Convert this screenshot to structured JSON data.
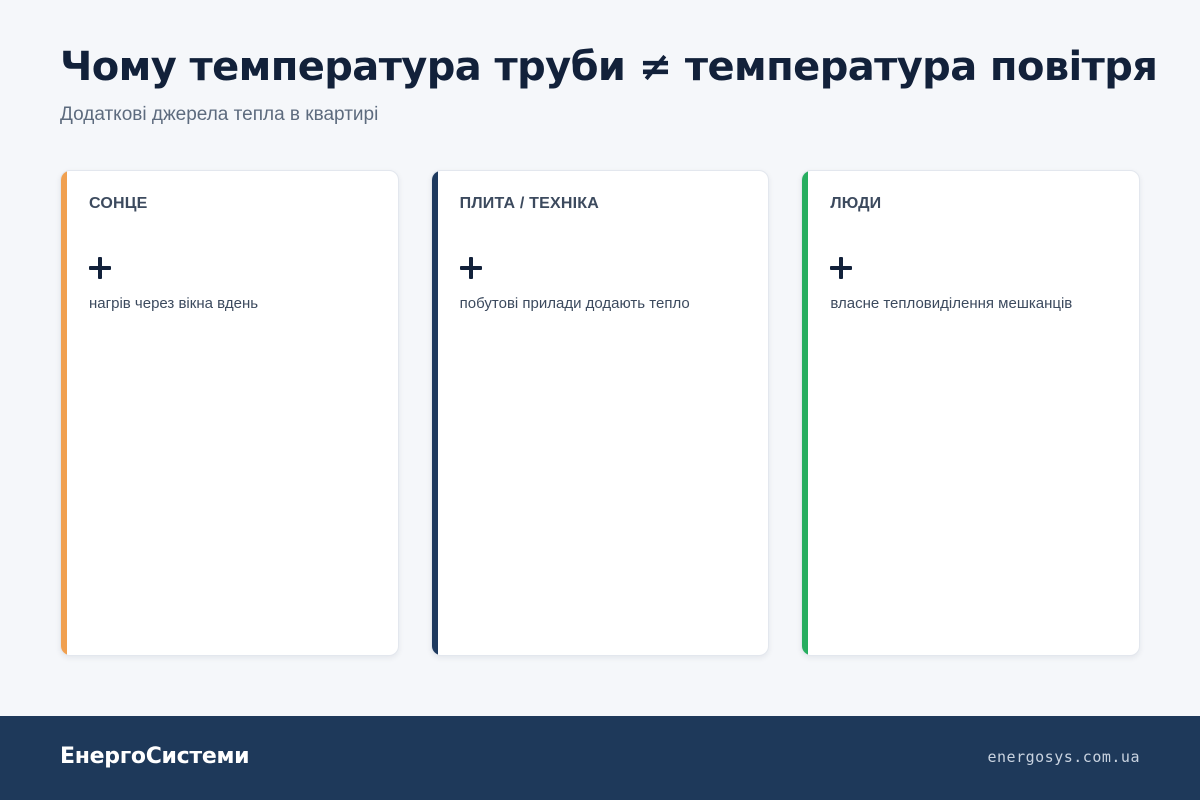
{
  "header": {
    "title": "Чому температура труби ≠ температура повітря",
    "subtitle": "Додаткові джерела тепла в квартирі"
  },
  "cards": [
    {
      "title": "СОНЦЕ",
      "sign": "+",
      "description": "нагрів через вікна вдень",
      "accent_color": "#f0a050"
    },
    {
      "title": "ПЛИТА / ТЕХНІКА",
      "sign": "+",
      "description": "побутові прилади додають тепло",
      "accent_color": "#1e3a5f"
    },
    {
      "title": "ЛЮДИ",
      "sign": "+",
      "description": "власне тепловиділення мешканців",
      "accent_color": "#27ae60"
    }
  ],
  "footer": {
    "brand": "ЕнергоСистеми",
    "url": "energosys.com.ua",
    "background_color": "#1e395a"
  },
  "colors": {
    "page_background": "#f5f7fa",
    "title_text": "#12213a",
    "muted_text": "#5d6b7e"
  }
}
